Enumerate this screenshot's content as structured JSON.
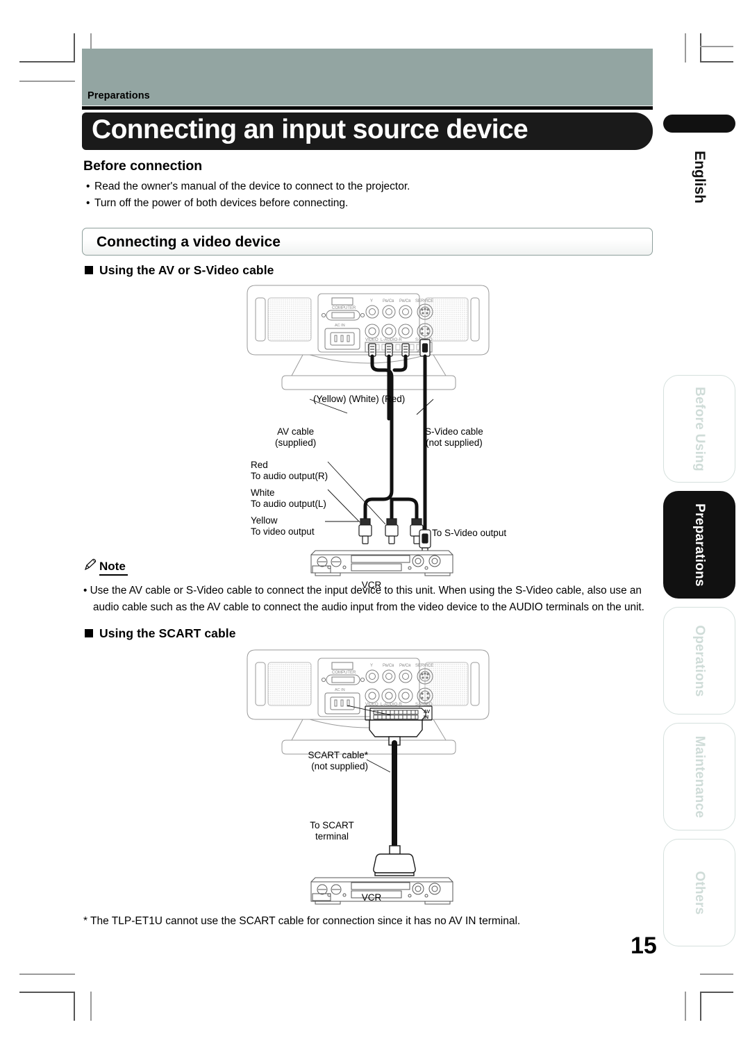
{
  "banner": {
    "section_label": "Preparations"
  },
  "title": "Connecting an input source device",
  "before_connection": {
    "heading": "Before connection",
    "bullets": [
      "Read the owner's manual of the device to connect to the projector.",
      "Turn off the power of both devices before connecting."
    ]
  },
  "section_box": {
    "label": "Connecting a video device"
  },
  "subheads": {
    "av_svideo": "Using the AV or S-Video cable",
    "scart": "Using the SCART cable"
  },
  "projector_ports": {
    "computer": "COMPUTER",
    "ac_in": "AC IN",
    "y": "Y",
    "pb_cb": "PB/CB",
    "pr_cr": "PR/CR",
    "service": "SERVICE",
    "video": "VIDEO",
    "audio": "L-AUDIO-R",
    "s_video": "S-VIDEO",
    "av_in_line1": "AV",
    "av_in_line2": "IN"
  },
  "av_diagram": {
    "plug_colors": "(Yellow) (White) (Red)",
    "av_cable_line1": "AV cable",
    "av_cable_line2": "(supplied)",
    "svideo_cable_line1": "S-Video cable",
    "svideo_cable_line2": "(not supplied)",
    "red_line1": "Red",
    "red_line2": "To audio output(R)",
    "white_line1": "White",
    "white_line2": "To audio output(L)",
    "yellow_line1": "Yellow",
    "yellow_line2": "To video output",
    "to_svideo_output": "To S-Video output",
    "device_label": "VCR"
  },
  "note": {
    "title": "Note",
    "icon": "pencil-icon",
    "body_line1": "• Use the AV cable or S-Video cable to connect the input device to this unit.  When using the S-Video cable, also use an",
    "body_line2": "audio cable such as the AV cable to connect the audio input from the video device to the AUDIO terminals on the unit."
  },
  "scart_diagram": {
    "cable_line1": "SCART cable*",
    "cable_line2": "(not supplied)",
    "terminal_line1": "To SCART",
    "terminal_line2": "terminal",
    "device_label": "VCR"
  },
  "footnote": "* The TLP-ET1U cannot use the SCART cable for connection since it has no AV IN terminal.",
  "page_number": "15",
  "index_tabs": [
    {
      "label": "English",
      "state": "active"
    },
    {
      "label": "Before Using",
      "state": "inactive"
    },
    {
      "label": "Preparations",
      "state": "active"
    },
    {
      "label": "Operations",
      "state": "inactive"
    },
    {
      "label": "Maintenance",
      "state": "inactive"
    },
    {
      "label": "Others",
      "state": "inactive"
    }
  ],
  "colors": {
    "banner_gray": "#93a5a2",
    "title_black": "#1a1a1a",
    "tab_pale": "#cfdcd8",
    "paper": "#ffffff"
  }
}
